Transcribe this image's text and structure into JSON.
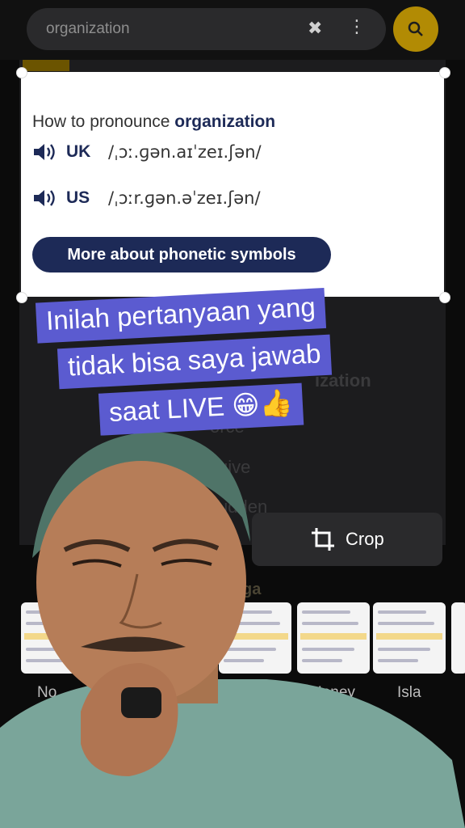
{
  "search": {
    "value": "organization"
  },
  "card": {
    "heading_prefix": "How to pronounce ",
    "heading_word": "organization",
    "rows": [
      {
        "region": "UK",
        "ipa": "/ˌɔː.ɡən.aɪˈzeɪ.ʃən/"
      },
      {
        "region": "US",
        "ipa": "/ˌɔːr.ɡən.əˈzeɪ.ʃən/"
      }
    ],
    "more_button": "More about phonetic symbols"
  },
  "caption": {
    "line1": "Inilah pertanyaan yang",
    "line2": "tidak bisa saya jawab",
    "line3": "saat LIVE 😁👍"
  },
  "crop": {
    "label": "Crop"
  },
  "thumbnails": {
    "labels": [
      "No",
      "Honey",
      "Isla"
    ]
  },
  "background": {
    "ghost1": "ization",
    "ghost2": "orce",
    "ghost3": "give",
    "ghost4": "udden",
    "ghost5": "ga"
  },
  "colors": {
    "accent_yellow": "#e8b400",
    "navy": "#1d2a57",
    "caption_bg": "#5b5bd0"
  }
}
